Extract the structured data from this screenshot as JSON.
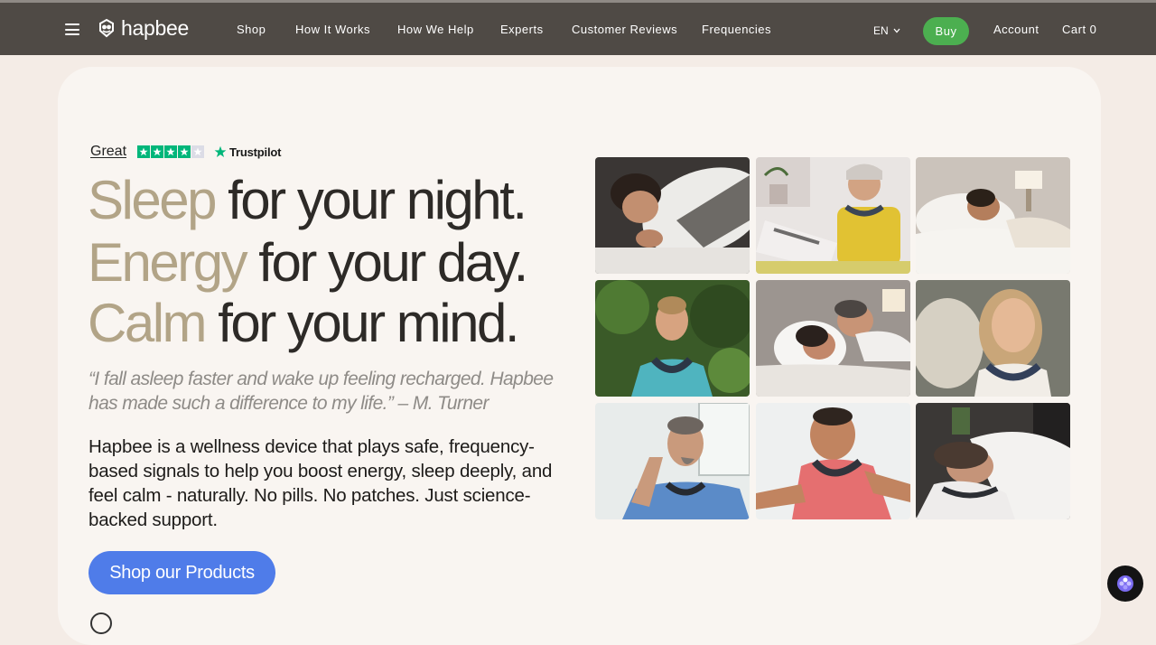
{
  "nav": {
    "logo_text": "hapbee",
    "links": [
      "Shop",
      "How It Works",
      "How We Help",
      "Experts",
      "Customer Reviews",
      "Frequencies"
    ],
    "language": "EN",
    "buy_label": "Buy",
    "account_label": "Account",
    "cart_label": "Cart 0"
  },
  "trustpilot": {
    "rating_word": "Great",
    "brand": "Trustpilot",
    "stars_filled": 4,
    "stars_total": 5
  },
  "hero": {
    "lines": [
      {
        "accent": "Sleep",
        "rest": "for your night."
      },
      {
        "accent": "Energy",
        "rest": "for your day."
      },
      {
        "accent": "Calm",
        "rest": "for your mind."
      }
    ],
    "quote": "“I fall asleep faster and wake up feeling recharged. Hapbee has made such a difference to my life.” – M. Turner",
    "description": "Hapbee is a wellness device that plays safe, frequency-based signals to help you boost energy, sleep deeply, and feel calm - naturally. No pills. No patches. Just science-backed support.",
    "cta_label": "Shop our Products"
  },
  "colors": {
    "nav_bg": "#4f4a45",
    "page_bg": "#f4ece6",
    "card_bg": "#f9f5f1",
    "accent_text": "#b2a487",
    "buy_green": "#4caf50",
    "cta_blue": "#4f7ce9",
    "trustpilot_green": "#00b67a"
  },
  "photos": [
    {
      "name": "photo-woman-sleeping-pillow",
      "icon": "photo"
    },
    {
      "name": "photo-woman-reading-magazine",
      "icon": "photo"
    },
    {
      "name": "photo-man-sleeping-bed",
      "icon": "photo"
    },
    {
      "name": "photo-woman-meditating-outdoors",
      "icon": "photo"
    },
    {
      "name": "photo-couple-sleeping",
      "icon": "photo"
    },
    {
      "name": "photo-woman-smiling-neckband",
      "icon": "photo"
    },
    {
      "name": "photo-man-thinking-neckband",
      "icon": "photo"
    },
    {
      "name": "photo-man-smiling-workout",
      "icon": "photo"
    },
    {
      "name": "photo-woman-resting-bed",
      "icon": "photo"
    }
  ],
  "icons": {
    "menu": "hamburger-icon",
    "logo": "bee-logo-icon",
    "language_caret": "chevron-down-icon",
    "chat": "chat-assistant-icon"
  }
}
